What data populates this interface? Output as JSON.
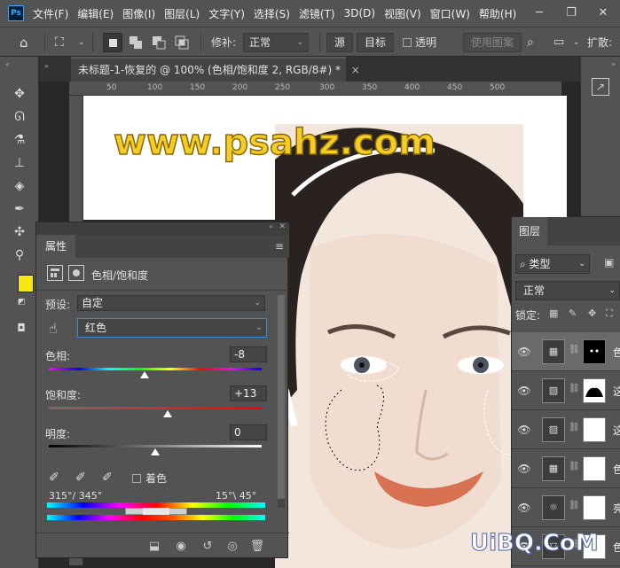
{
  "app": {
    "logo": "Ps"
  },
  "menu": [
    "文件(F)",
    "编辑(E)",
    "图像(I)",
    "图层(L)",
    "文字(Y)",
    "选择(S)",
    "滤镜(T)",
    "3D(D)",
    "视图(V)",
    "窗口(W)",
    "帮助(H)"
  ],
  "options": {
    "repair_label": "修补:",
    "mode": "正常",
    "source_btn": "源",
    "target_btn": "目标",
    "transparent_label": "透明",
    "pattern_btn": "使用图案",
    "expand_label": "扩散:"
  },
  "document": {
    "tab_title": "未标题-1-恢复的 @ 100% (色相/饱和度 2, RGB/8#) *",
    "close": "×"
  },
  "ruler": {
    "ticks": [
      "50",
      "100",
      "150",
      "200",
      "250",
      "300",
      "350",
      "400",
      "450",
      "500"
    ]
  },
  "watermark": "www.psahz.com",
  "bottom_watermark": "UiBQ.CoM",
  "properties": {
    "tab": "属性",
    "adjustment_name": "色相/饱和度",
    "preset_label": "预设:",
    "preset_value": "自定",
    "channel_value": "红色",
    "hue_label": "色相:",
    "hue_value": "-8",
    "hue_pct": 0.45,
    "sat_label": "饱和度:",
    "sat_value": "+13",
    "sat_pct": 0.56,
    "light_label": "明度:",
    "light_value": "0",
    "light_pct": 0.5,
    "colorize_label": "着色",
    "range_left": "315°/ 345°",
    "range_right": "15°\\ 45°"
  },
  "layers": {
    "tab": "图层",
    "filter_kind": "类型",
    "blend_mode": "正常",
    "lock_label": "锁定:",
    "rows": [
      {
        "name": "色",
        "icon": "adj",
        "selected": true
      },
      {
        "name": "这",
        "icon": "img"
      },
      {
        "name": "这",
        "icon": "img"
      },
      {
        "name": "色",
        "icon": "adj"
      },
      {
        "name": "亮",
        "icon": "sun"
      },
      {
        "name": "色",
        "icon": "grad"
      }
    ]
  },
  "colors": {
    "foreground": "#f7e80f",
    "background": "#ffffff",
    "selection_accent": "#ffffff"
  }
}
